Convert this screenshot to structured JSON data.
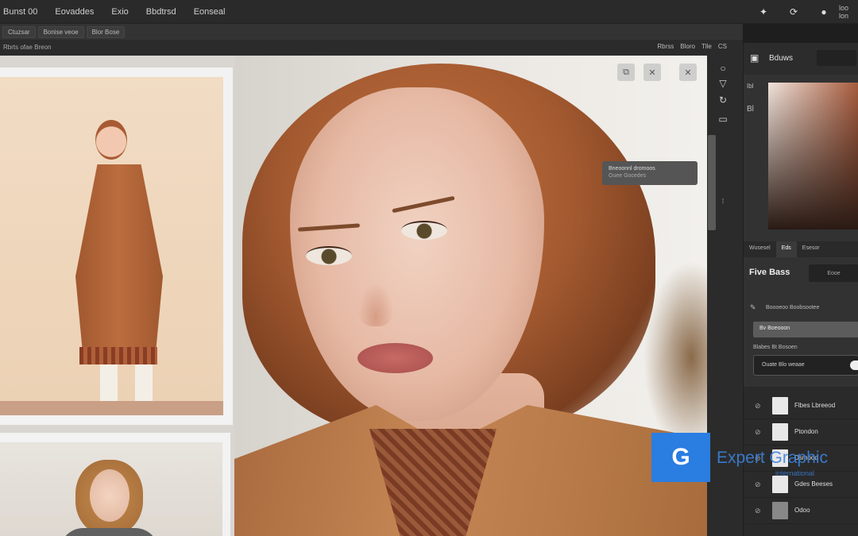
{
  "menubar": {
    "items": [
      "Bunst 00",
      "Eovaddes",
      "Exio",
      "Bbdtrsd",
      "Eonseal"
    ],
    "account": "loo lon"
  },
  "tabs": [
    "Ctuzsar",
    "Bonise veoe",
    "Blor Bose"
  ],
  "options": {
    "breadcrumb": "Rbrts  ofae Breon",
    "right_items": [
      "Rbrss",
      "Bloro",
      "Tlle",
      "CS"
    ]
  },
  "tooltip": {
    "title": "Bneoonnl dromoos",
    "subtitle": "Ouee Gocedes"
  },
  "panel": {
    "title": "Bduws",
    "side_labels": [
      "Ibl",
      "Bl"
    ],
    "tabs": [
      "Wusesel",
      "Eds",
      "Esesor"
    ],
    "section_label": "Five Bass",
    "section_button": "Eooe",
    "row1": "Boooeoo  Boobsootee",
    "field1": "Bv Boeooon",
    "row2": "Blabes  Bt  Bosoen",
    "toggle_field": "Ouate Blo  weaae",
    "layers": [
      "Flbes Lbreeod",
      "Ptondon",
      "Dsmood",
      "Gdes Beeses",
      "Odoo"
    ]
  },
  "watermark": {
    "logo": "G",
    "name": "Expert Graphic",
    "tagline": "international"
  },
  "colors": {
    "accent": "#2a7de1",
    "panel_bg": "#323232",
    "swatch_warm": "#a65a3c"
  }
}
